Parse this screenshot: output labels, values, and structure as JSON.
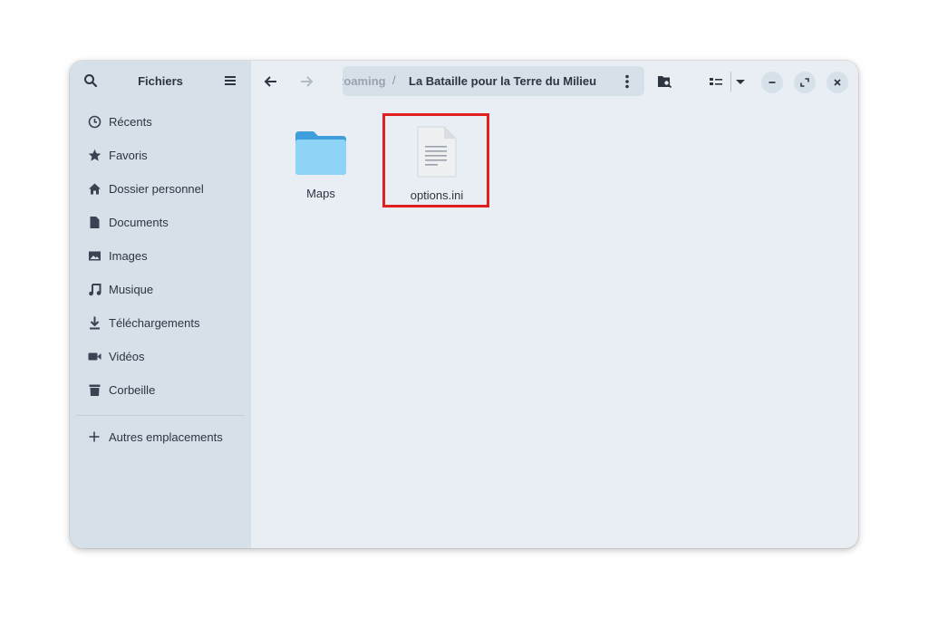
{
  "sidebar": {
    "title": "Fichiers",
    "items": [
      {
        "label": "Récents",
        "icon": "clock-icon"
      },
      {
        "label": "Favoris",
        "icon": "star-icon"
      },
      {
        "label": "Dossier personnel",
        "icon": "home-icon"
      },
      {
        "label": "Documents",
        "icon": "document-icon"
      },
      {
        "label": "Images",
        "icon": "image-icon"
      },
      {
        "label": "Musique",
        "icon": "music-icon"
      },
      {
        "label": "Téléchargements",
        "icon": "download-icon"
      },
      {
        "label": "Vidéos",
        "icon": "video-icon"
      },
      {
        "label": "Corbeille",
        "icon": "trash-icon"
      }
    ],
    "other_locations": "Autres emplacements"
  },
  "pathbar": {
    "previous": "Roaming",
    "separator": "/",
    "current": "La Bataille pour la Terre du Milieu"
  },
  "files": [
    {
      "name": "Maps",
      "type": "folder"
    },
    {
      "name": "options.ini",
      "type": "text-file"
    }
  ],
  "colors": {
    "accent_folder": "#5bbcf0",
    "highlight": "#e02020",
    "sidebar_bg": "#d6e0e8",
    "content_bg": "#e9eef5"
  }
}
